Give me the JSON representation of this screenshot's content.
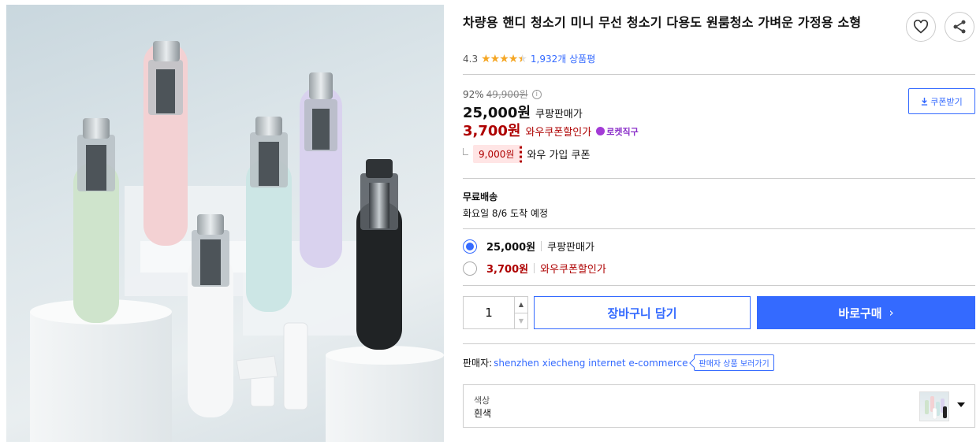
{
  "product": {
    "title": "차량용 핸디 청소기 미니 무선 청소기 다용도 원룸청소 가벼운 가정용 소형",
    "image_alt": "Portable handheld vacuum cleaners in green, pink, white, blue, purple and black on white pedestals",
    "rating": "4.3",
    "rating_value": 4.3,
    "review_count": "1,932개 상품평"
  },
  "icons": {
    "favorite": "heart-icon",
    "share": "share-icon",
    "download": "download-icon",
    "info": "info-icon",
    "rocket": "rocket-direct-icon",
    "caret": "caret-down-icon",
    "chevron": "chevron-right-icon"
  },
  "pricing": {
    "discount_rate": "92%",
    "original_price": "49,900원",
    "info_glyph": "i",
    "sale_price": "25,000원",
    "sale_label": "쿠팡판매가",
    "wow_price": "3,700원",
    "wow_label": "와우쿠폰할인가",
    "rocket_label": "로켓직구",
    "coupon_download_label": "쿠폰받기",
    "wow_coupon_amount": "9,000원",
    "wow_coupon_label": "와우 가입 쿠폰"
  },
  "shipping": {
    "type": "무료배송",
    "arrival": "화요일 8/6 도착 예정"
  },
  "price_options": [
    {
      "price": "25,000원",
      "label": "쿠팡판매가",
      "selected": true
    },
    {
      "price": "3,700원",
      "label": "와우쿠폰할인가",
      "selected": false
    }
  ],
  "purchase": {
    "quantity": "1",
    "cart_label": "장바구니 담기",
    "buy_label": "바로구매",
    "buy_chevron": "›"
  },
  "seller": {
    "label": "판매자:",
    "name": "shenzhen xiecheng internet e-commerce",
    "link_label": "판매자 상품 보러가기"
  },
  "option": {
    "name": "색상",
    "value": "흰색"
  },
  "colors": {
    "accent": "#346aff",
    "price_red": "#ae0000",
    "star": "#f5a623",
    "rocket_purple": "#a33ad6"
  }
}
